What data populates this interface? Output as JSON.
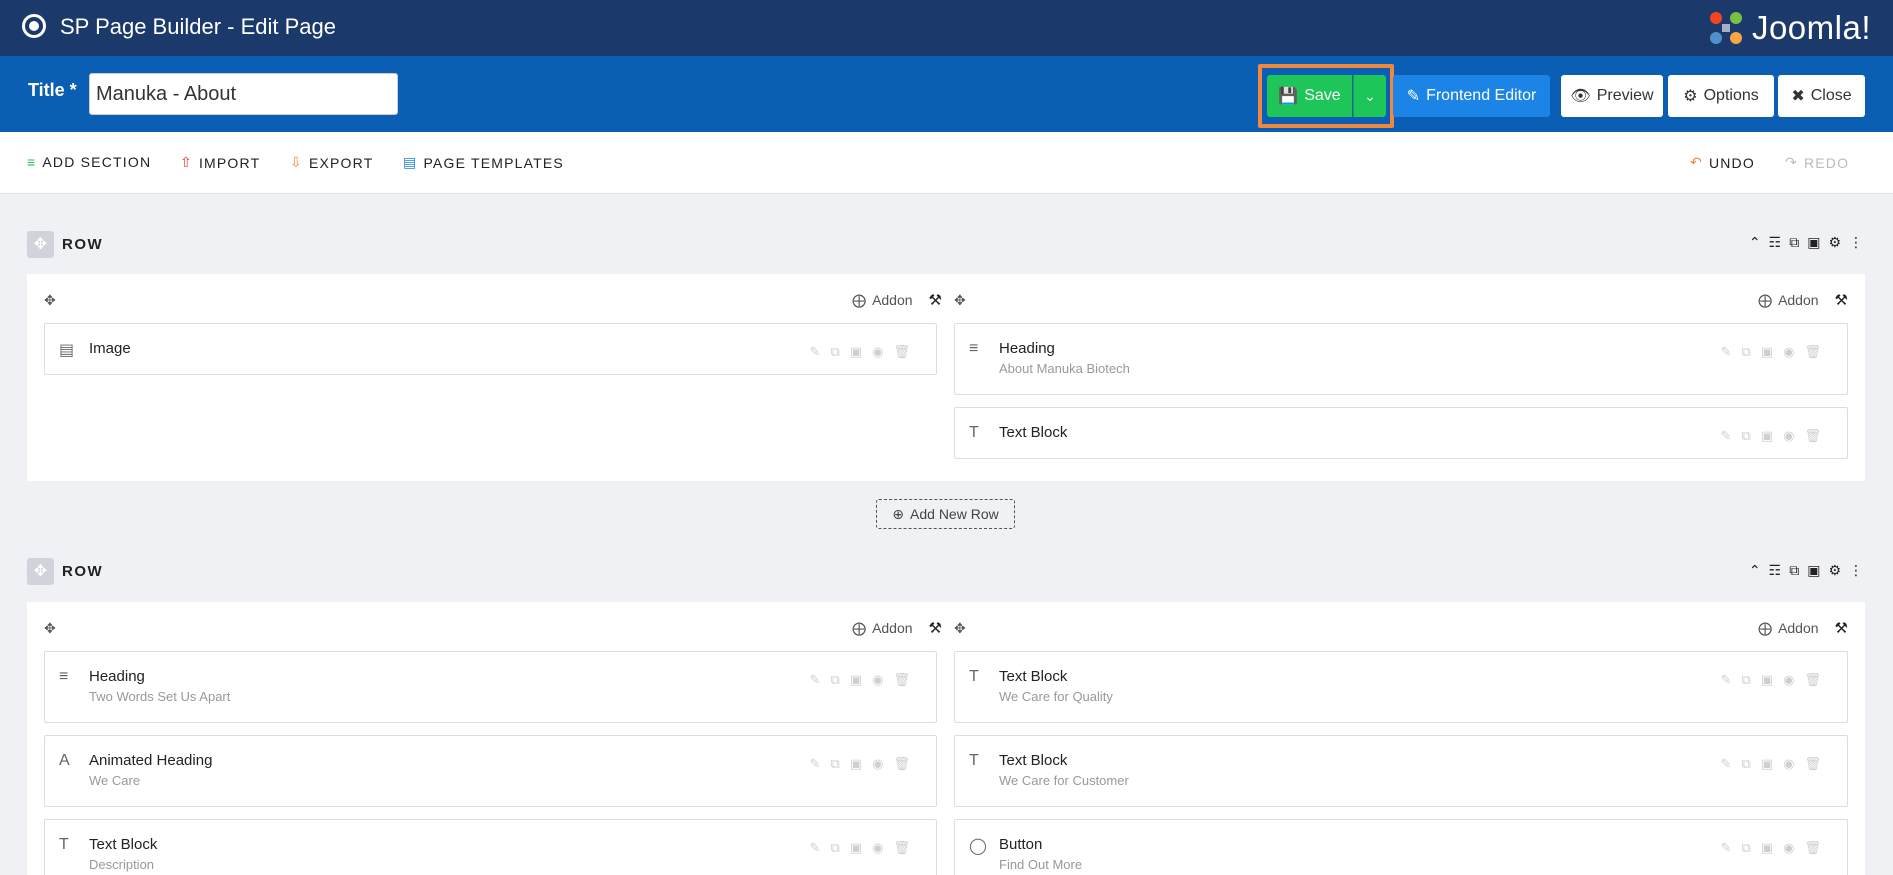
{
  "app": {
    "title": "SP Page Builder - Edit Page",
    "logo_text": "Joomla!"
  },
  "titlebar": {
    "label": "Title *",
    "value": "Manuka - About",
    "buttons": {
      "save": "Save",
      "frontend": "Frontend Editor",
      "preview": "Preview",
      "options": "Options",
      "close": "Close"
    }
  },
  "toolbar": {
    "add_section": "ADD SECTION",
    "import": "IMPORT",
    "export": "EXPORT",
    "page_templates": "PAGE TEMPLATES",
    "undo": "UNDO",
    "redo": "REDO"
  },
  "rows": [
    {
      "label": "ROW",
      "columns": [
        {
          "addon_label": "Addon",
          "addons": [
            {
              "icon": "image-icon",
              "title": "Image",
              "subtitle": ""
            }
          ]
        },
        {
          "addon_label": "Addon",
          "addons": [
            {
              "icon": "heading-icon",
              "title": "Heading",
              "subtitle": "About Manuka Biotech"
            },
            {
              "icon": "text-block-icon",
              "title": "Text Block",
              "subtitle": ""
            }
          ]
        }
      ]
    },
    {
      "label": "ROW",
      "columns": [
        {
          "addon_label": "Addon",
          "addons": [
            {
              "icon": "heading-icon",
              "title": "Heading",
              "subtitle": "Two Words Set Us Apart"
            },
            {
              "icon": "animated-heading-icon",
              "title": "Animated Heading",
              "subtitle": "We Care"
            },
            {
              "icon": "text-block-icon",
              "title": "Text Block",
              "subtitle": "Description"
            }
          ]
        },
        {
          "addon_label": "Addon",
          "addons": [
            {
              "icon": "text-block-icon",
              "title": "Text Block",
              "subtitle": "We Care for Quality"
            },
            {
              "icon": "text-block-icon",
              "title": "Text Block",
              "subtitle": "We Care for Customer"
            },
            {
              "icon": "button-icon",
              "title": "Button",
              "subtitle": "Find Out More"
            }
          ]
        }
      ]
    }
  ],
  "add_new_row": "Add New Row",
  "colors": {
    "topbar": "#1b3a6b",
    "titlebar": "#0a5eb3",
    "save": "#1ec65a",
    "frontend": "#1c84e6",
    "highlight": "#f0873d"
  }
}
